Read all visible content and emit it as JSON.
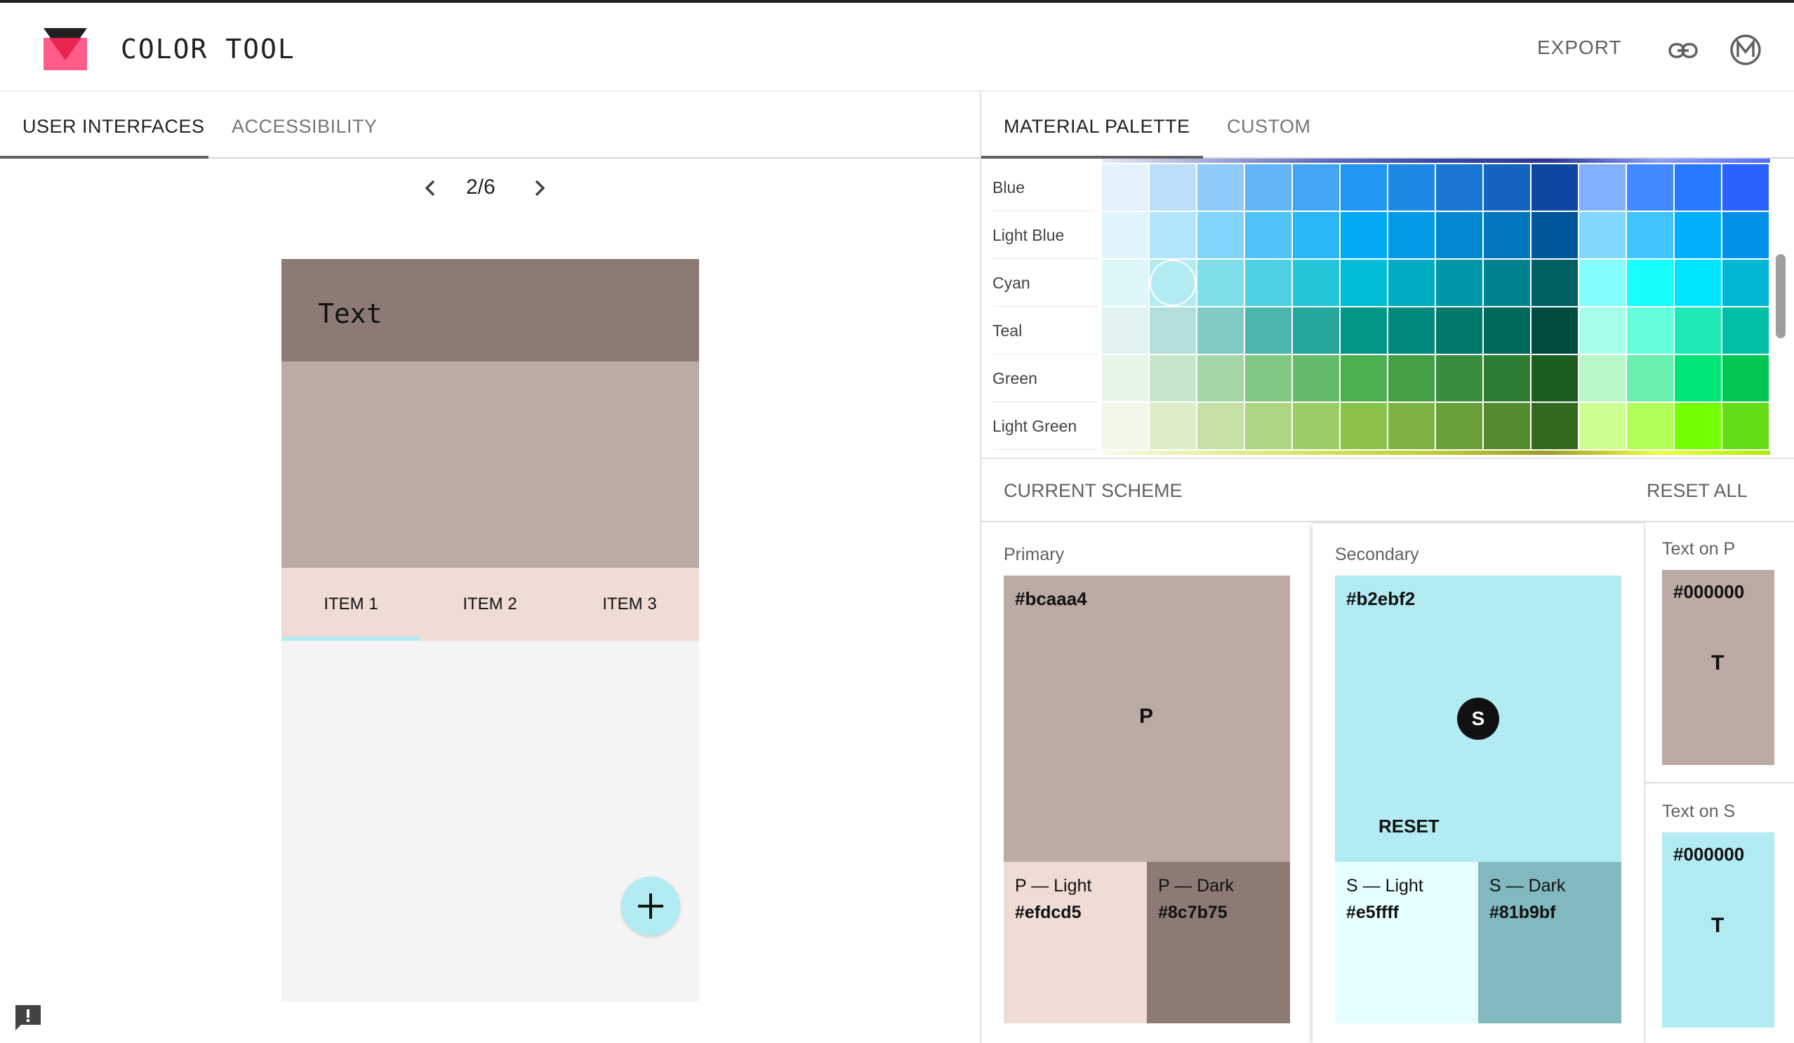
{
  "app": {
    "title": "COLOR TOOL",
    "export_label": "EXPORT"
  },
  "left_tabs": [
    {
      "label": "USER INTERFACES",
      "active": true
    },
    {
      "label": "ACCESSIBILITY",
      "active": false
    }
  ],
  "pager": {
    "label": "2/6"
  },
  "phone": {
    "title": "Text",
    "tabs": [
      "ITEM 1",
      "ITEM 2",
      "ITEM 3"
    ],
    "colors": {
      "app_bar": "#8c7b75",
      "hero": "#bcaaa4",
      "tabs": "#efdcd5",
      "indicator": "#b2ebf2",
      "fab": "#b2ebf2",
      "body": "#f4f4f4"
    }
  },
  "right_tabs": [
    {
      "label": "MATERIAL PALETTE",
      "active": true
    },
    {
      "label": "CUSTOM",
      "active": false
    }
  ],
  "palette": {
    "rows": [
      {
        "name": "Blue",
        "colors": [
          "#e3f2fd",
          "#bbdefb",
          "#90caf9",
          "#64b5f6",
          "#42a5f5",
          "#2196f3",
          "#1e88e5",
          "#1976d2",
          "#1565c0",
          "#0d47a1",
          "#82b1ff",
          "#448aff",
          "#2979ff",
          "#2962ff"
        ]
      },
      {
        "name": "Light Blue",
        "colors": [
          "#e1f5fe",
          "#b3e5fc",
          "#81d4fa",
          "#4fc3f7",
          "#29b6f6",
          "#03a9f4",
          "#039be5",
          "#0288d1",
          "#0277bd",
          "#01579b",
          "#80d8ff",
          "#40c4ff",
          "#00b0ff",
          "#0091ea"
        ]
      },
      {
        "name": "Cyan",
        "colors": [
          "#e0f7fa",
          "#b2ebf2",
          "#80deea",
          "#4dd0e1",
          "#26c6da",
          "#00bcd4",
          "#00acc1",
          "#0097a7",
          "#00838f",
          "#006064",
          "#84ffff",
          "#18ffff",
          "#00e5ff",
          "#00b8d4"
        ],
        "selected_index": 1
      },
      {
        "name": "Teal",
        "colors": [
          "#e0f2f1",
          "#b2dfdb",
          "#80cbc4",
          "#4db6ac",
          "#26a69a",
          "#009688",
          "#00897b",
          "#00796b",
          "#00695c",
          "#004d40",
          "#a7ffeb",
          "#64ffda",
          "#1de9b6",
          "#00bfa5"
        ]
      },
      {
        "name": "Green",
        "colors": [
          "#e8f5e9",
          "#c8e6c9",
          "#a5d6a7",
          "#81c784",
          "#66bb6a",
          "#4caf50",
          "#43a047",
          "#388e3c",
          "#2e7d32",
          "#1b5e20",
          "#b9f6ca",
          "#69f0ae",
          "#00e676",
          "#00c853"
        ]
      },
      {
        "name": "Light Green",
        "colors": [
          "#f1f8e9",
          "#dcedc8",
          "#c5e1a5",
          "#aed581",
          "#9ccc65",
          "#8bc34a",
          "#7cb342",
          "#689f38",
          "#558b2f",
          "#33691e",
          "#ccff90",
          "#b2ff59",
          "#76ff03",
          "#64dd17"
        ]
      }
    ]
  },
  "scheme": {
    "title": "CURRENT SCHEME",
    "reset_all_label": "RESET ALL",
    "primary": {
      "label": "Primary",
      "hex": "#bcaaa4",
      "letter": "P",
      "light_label": "P — Light",
      "light_hex": "#efdcd5",
      "dark_label": "P — Dark",
      "dark_hex": "#8c7b75"
    },
    "secondary": {
      "label": "Secondary",
      "hex": "#b2ebf2",
      "letter": "S",
      "reset_label": "RESET",
      "light_label": "S — Light",
      "light_hex": "#e5ffff",
      "dark_label": "S — Dark",
      "dark_hex": "#81b9bf"
    },
    "text_on_p": {
      "label": "Text on P",
      "hex": "#000000",
      "letter": "T"
    },
    "text_on_s": {
      "label": "Text on S",
      "hex": "#000000",
      "letter": "T"
    }
  }
}
